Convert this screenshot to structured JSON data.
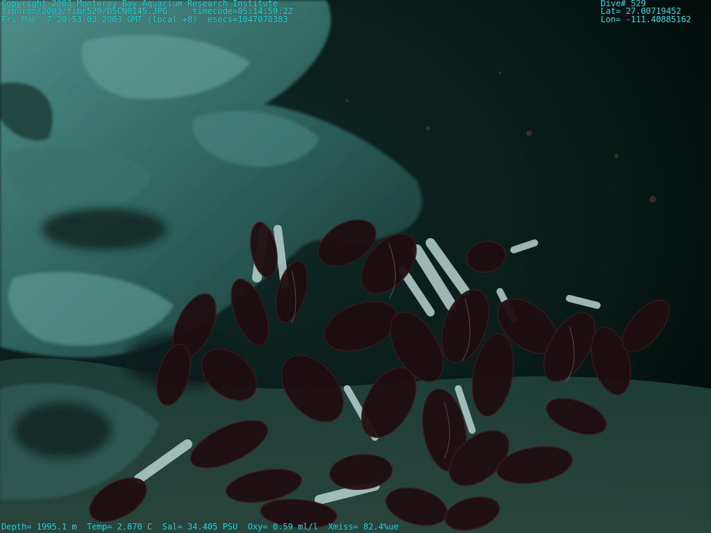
{
  "overlay": {
    "copyright": "Copyright 2003 Monterey Bay Aquarium Research Institute",
    "file_path": "Tiburon/2003/tibr529/DSCN0145.JPG",
    "timecode": "timecode=05:14:59:22",
    "datetime": "Fri Mar  7 20:53:03 2003 GMT (local +8)",
    "esecs": "esecs=1047070383",
    "dive": "Dive# 529",
    "lat": "Lat= 27.00719452",
    "lon": "Lon= -111.40885162",
    "depth": "Depth= 1995.1 m",
    "temp": "Temp= 2.870 C",
    "sal": "Sal= 34.405 PSU",
    "oxy": "Oxy= 0.59 ml/l",
    "xmiss": "Xmiss= 82.4%ue"
  },
  "colors": {
    "overlay_text": "#27d8de",
    "water": "#05120f",
    "rock": "#3f7b76",
    "worm_plume": "#1e0d10",
    "worm_tube": "#b7d3cf"
  }
}
